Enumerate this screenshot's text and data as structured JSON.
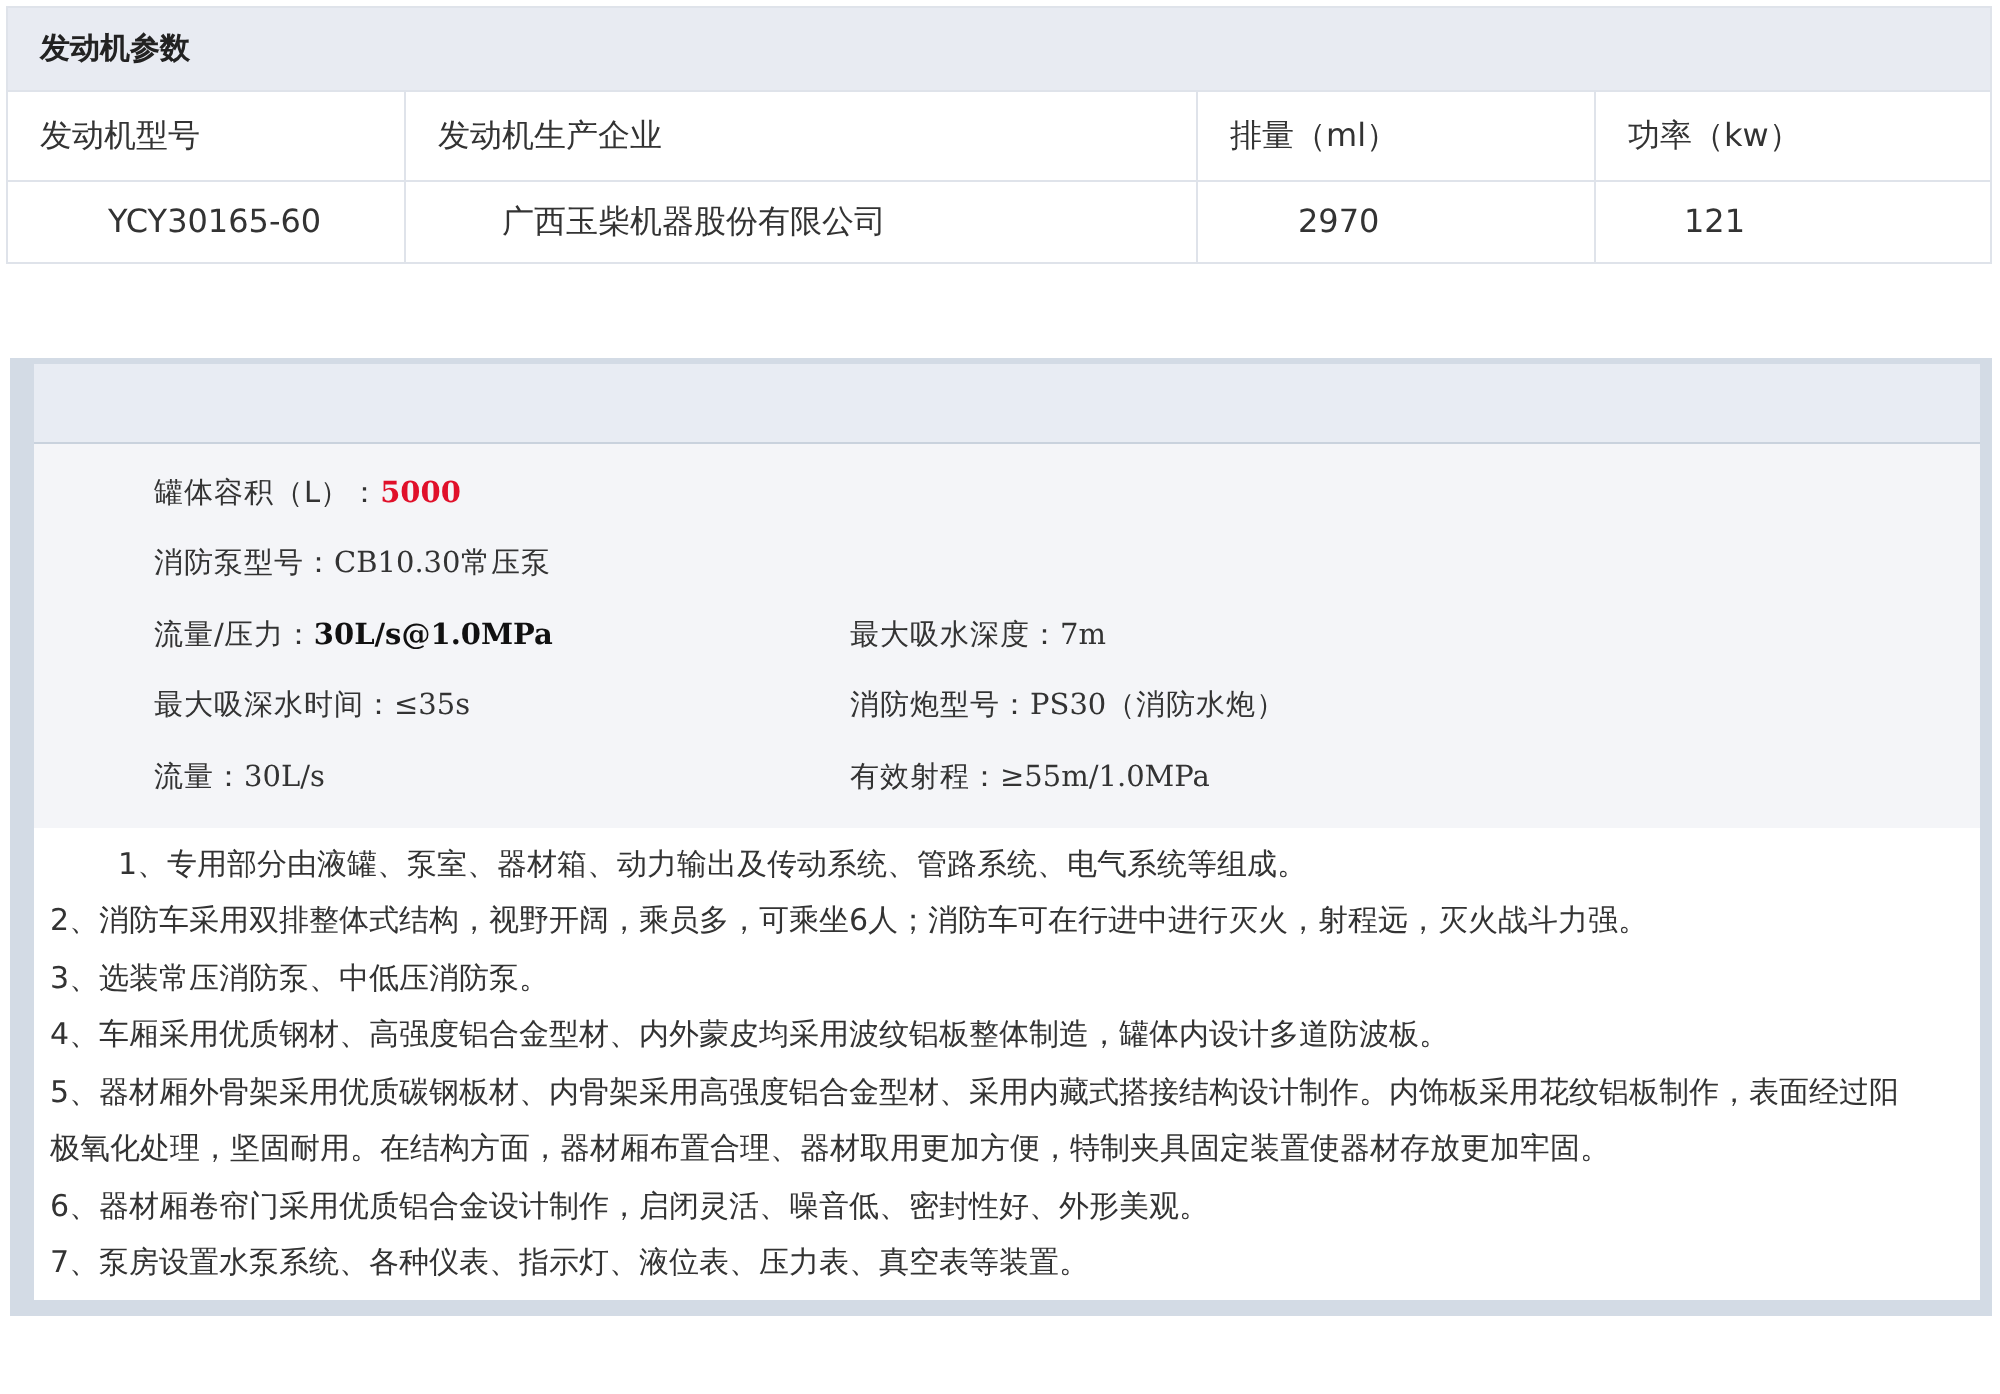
{
  "engine_params": {
    "title": "发动机参数",
    "columns": [
      "发动机型号",
      "发动机生产企业",
      "排量（ml）",
      "功率（kw）"
    ],
    "rows": [
      [
        "YCY30165-60",
        "广西玉柴机器股份有限公司",
        "2970",
        "121"
      ]
    ]
  },
  "specs": {
    "rows": [
      {
        "left": {
          "label": "罐体容积（L）：",
          "value": "5000",
          "kind": "highlight"
        }
      },
      {
        "left": {
          "label": "消防泵型号：",
          "value": "CB10.30常压泵",
          "kind": "plain"
        }
      },
      {
        "left": {
          "label": "流量/压力：",
          "value": "30L/s@1.0MPa",
          "kind": "bold"
        },
        "right": {
          "label": "最大吸水深度：",
          "value": "7m",
          "kind": "plain"
        }
      },
      {
        "left": {
          "label": "最大吸深水时间：",
          "value": "≤35s",
          "kind": "plain"
        },
        "right": {
          "label": "消防炮型号：",
          "value": "PS30（消防水炮）",
          "kind": "plain"
        }
      },
      {
        "left": {
          "label": "流量：",
          "value": "30L/s",
          "kind": "plain"
        },
        "right": {
          "label": "有效射程：",
          "value": "≥55m/1.0MPa",
          "kind": "plain"
        }
      }
    ]
  },
  "description": [
    {
      "text": "1、专用部分由液罐、泵室、器材箱、动力输出及传动系统、管路系统、电气系统等组成。",
      "indent": true
    },
    {
      "text": "2、消防车采用双排整体式结构，视野开阔，乘员多，可乘坐6人；消防车可在行进中进行灭火，射程远，灭火战斗力强。",
      "indent": false
    },
    {
      "text": "3、选装常压消防泵、中低压消防泵。",
      "indent": false
    },
    {
      "text": "4、车厢采用优质钢材、高强度铝合金型材、内外蒙皮均采用波纹铝板整体制造，罐体内设计多道防波板。",
      "indent": false
    },
    {
      "text": "5、器材厢外骨架采用优质碳钢板材、内骨架采用高强度铝合金型材、采用内藏式搭接结构设计制作。内饰板采用花纹铝板制作，表面经过阳极氧化处理，坚固耐用。在结构方面，器材厢布置合理、器材取用更加方便，特制夹具固定装置使器材存放更加牢固。",
      "indent": false
    },
    {
      "text": "6、器材厢卷帘门采用优质铝合金设计制作，启闭灵活、噪音低、密封性好、外形美观。",
      "indent": false
    },
    {
      "text": "7、泵房设置水泵系统、各种仪表、指示灯、液位表、压力表、真空表等装置。",
      "indent": false
    }
  ]
}
